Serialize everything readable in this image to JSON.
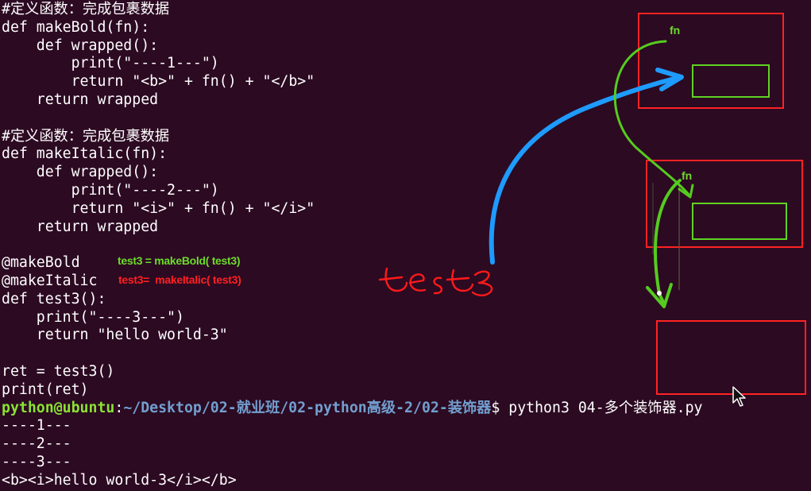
{
  "code": {
    "lines": [
      "#定义函数：完成包裹数据",
      "def makeBold(fn):",
      "    def wrapped():",
      "        print(\"----1---\")",
      "        return \"<b>\" + fn() + \"</b>\"",
      "    return wrapped",
      "",
      "#定义函数：完成包裹数据",
      "def makeItalic(fn):",
      "    def wrapped():",
      "        print(\"----2---\")",
      "        return \"<i>\" + fn() + \"</i>\"",
      "    return wrapped",
      "",
      "@makeBold",
      "@makeItalic",
      "def test3():",
      "    print(\"----3---\")",
      "    return \"hello world-3\"",
      "",
      "ret = test3()",
      "print(ret)"
    ]
  },
  "prompt": {
    "user": "python@ubuntu",
    "colon": ":",
    "path": "~/Desktop/02-就业班/02-python高级-2/02-装饰器",
    "command": "$ python3 04-多个装饰器.py"
  },
  "output": {
    "lines": [
      "----1---",
      "----2---",
      "----3---",
      "<b><i>hello world-3</i></b>"
    ]
  },
  "annotations": {
    "bold_note": "test3 = makeBold( test3)",
    "italic_note": "test3=  makeItalic( test3)",
    "handwritten": "test3",
    "fn_top": "fn",
    "fn_middle": "fn"
  },
  "colors": {
    "background": "#2c0a22",
    "text": "#ffffff",
    "prompt_user": "#8ae234",
    "prompt_path": "#729fcf",
    "annotation_green": "#6cdc2a",
    "annotation_red": "#ff2020",
    "arrow_blue": "#1e9bff"
  }
}
